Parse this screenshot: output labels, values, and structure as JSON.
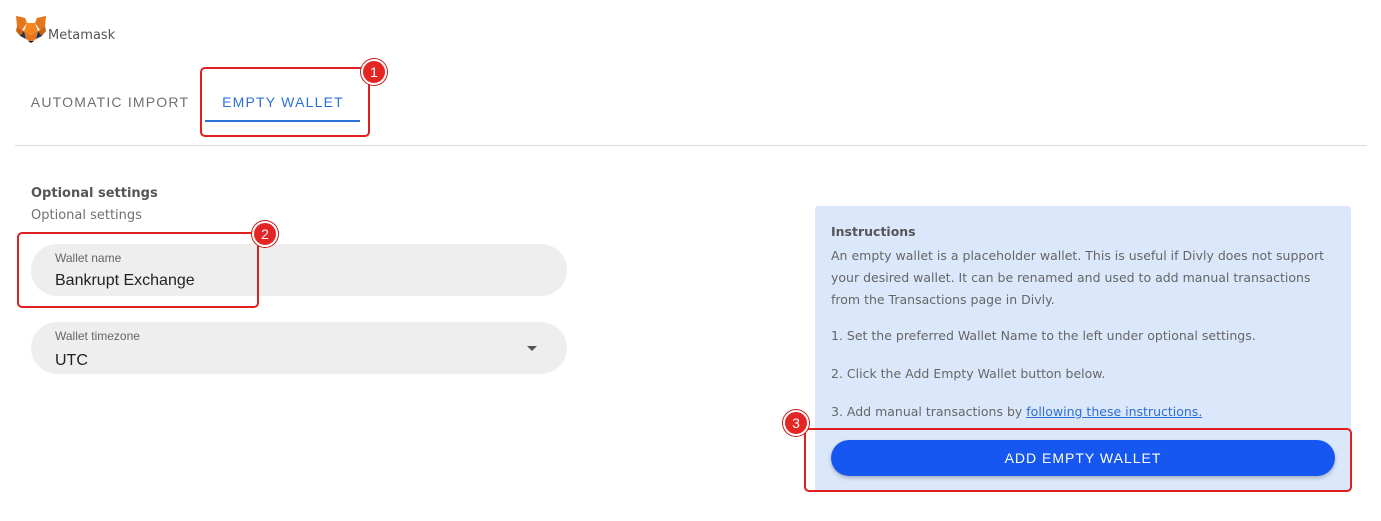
{
  "brand": {
    "name": "Metamask",
    "icon": "metamask-fox-icon"
  },
  "tabs": [
    {
      "label": "AUTOMATIC IMPORT",
      "active": false
    },
    {
      "label": "EMPTY WALLET",
      "active": true
    }
  ],
  "settings": {
    "title": "Optional settings",
    "subtitle": "Optional settings",
    "wallet_name": {
      "label": "Wallet name",
      "value": "Bankrupt Exchange"
    },
    "wallet_timezone": {
      "label": "Wallet timezone",
      "value": "UTC",
      "icon": "chevron-down-icon"
    }
  },
  "instructions": {
    "title": "Instructions",
    "description": "An empty wallet is a placeholder wallet. This is useful if Divly does not support your desired wallet. It can be renamed and used to add manual transactions from the Transactions page in Divly.",
    "step1": "1. Set the preferred Wallet Name to the left under optional settings.",
    "step2": "2. Click the Add Empty Wallet button below.",
    "step3_prefix": "3. Add manual transactions by ",
    "step3_link": "following these instructions.",
    "button_label": "ADD EMPTY WALLET"
  },
  "annotations": {
    "badge1": "1",
    "badge2": "2",
    "badge3": "3"
  },
  "colors": {
    "accent": "#2c6fd6",
    "button": "#1557f0",
    "panel": "#dbe8fc",
    "annotation": "#e02020"
  }
}
